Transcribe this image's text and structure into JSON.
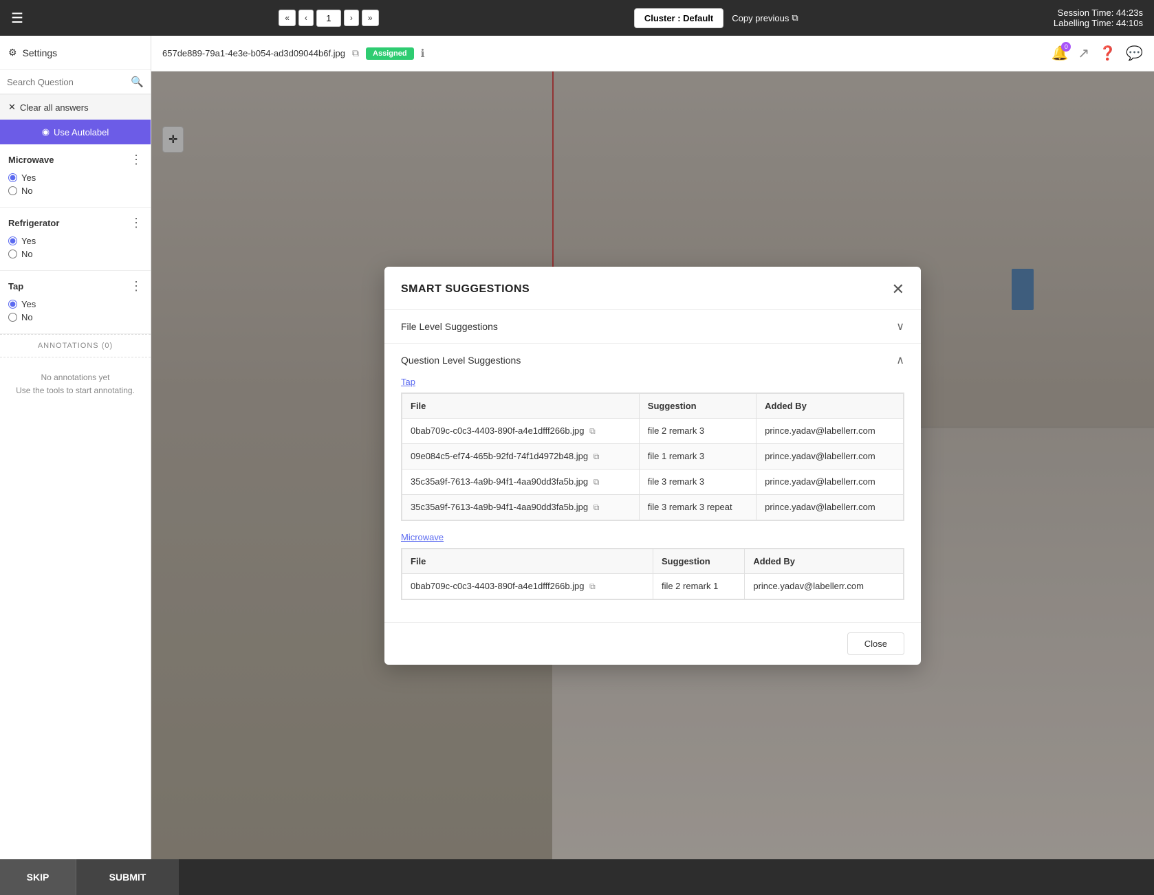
{
  "topBar": {
    "navButtons": [
      "«",
      "‹",
      "1",
      "›",
      "»"
    ],
    "pageNumber": "1",
    "clusterLabel": "Cluster : Default",
    "copyPrevious": "Copy previous",
    "sessionTime": "Session Time: 44:23s",
    "labellingTime": "Labelling Time: 44:10s"
  },
  "sidebar": {
    "settingsLabel": "Settings",
    "searchPlaceholder": "Search Question",
    "clearLabel": "Clear all answers",
    "autolabelLabel": "Use Autolabel",
    "questions": [
      {
        "id": "microwave",
        "label": "Microwave",
        "options": [
          "Yes",
          "No"
        ],
        "selectedIndex": 0
      },
      {
        "id": "refrigerator",
        "label": "Refrigerator",
        "options": [
          "Yes",
          "No"
        ],
        "selectedIndex": 0
      },
      {
        "id": "tap",
        "label": "Tap",
        "options": [
          "Yes",
          "No"
        ],
        "selectedIndex": 0
      }
    ],
    "annotationsLabel": "ANNOTATIONS (0)",
    "noAnnotationsText": "No annotations yet",
    "noAnnotationsSubtext": "Use the tools to start annotating."
  },
  "fileHeader": {
    "fileName": "657de889-79a1-4e3e-b054-ad3d09044b6f.jpg",
    "status": "Assigned",
    "notificationCount": "0"
  },
  "modal": {
    "title": "SMART SUGGESTIONS",
    "fileLevelLabel": "File Level Suggestions",
    "questionLevelLabel": "Question Level Suggestions",
    "subsections": [
      {
        "id": "tap",
        "label": "Tap",
        "columns": [
          "File",
          "Suggestion",
          "Added By"
        ],
        "rows": [
          {
            "file": "0bab709c-c0c3-4403-890f-a4e1dfff266b.jpg",
            "suggestion": "file 2 remark 3",
            "addedBy": "prince.yadav@labellerr.com"
          },
          {
            "file": "09e084c5-ef74-465b-92fd-74f1d4972b48.jpg",
            "suggestion": "file 1 remark 3",
            "addedBy": "prince.yadav@labellerr.com"
          },
          {
            "file": "35c35a9f-7613-4a9b-94f1-4aa90dd3fa5b.jpg",
            "suggestion": "file 3 remark 3",
            "addedBy": "prince.yadav@labellerr.com"
          },
          {
            "file": "35c35a9f-7613-4a9b-94f1-4aa90dd3fa5b.jpg",
            "suggestion": "file 3 remark 3 repeat",
            "addedBy": "prince.yadav@labellerr.com"
          }
        ]
      },
      {
        "id": "microwave",
        "label": "Microwave",
        "columns": [
          "File",
          "Suggestion",
          "Added By"
        ],
        "rows": [
          {
            "file": "0bab709c-c0c3-4403-890f-a4e1dfff266b.jpg",
            "suggestion": "file 2 remark 1",
            "addedBy": "prince.yadav@labellerr.com"
          }
        ]
      }
    ],
    "closeLabel": "Close"
  },
  "bottomBar": {
    "skipLabel": "SKIP",
    "submitLabel": "SUBMIT"
  }
}
